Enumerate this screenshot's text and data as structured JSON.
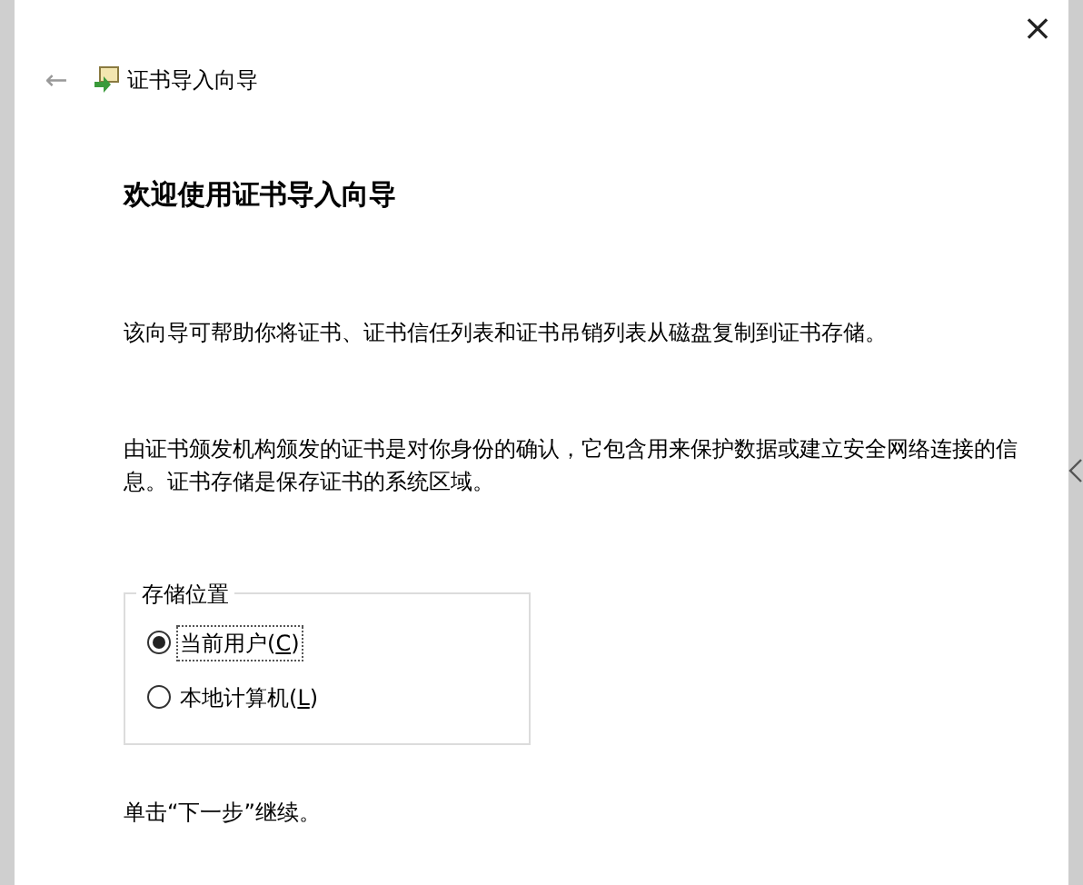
{
  "window": {
    "close_glyph": "×"
  },
  "header": {
    "back_glyph": "←",
    "title": "证书导入向导"
  },
  "heading": "欢迎使用证书导入向导",
  "paragraphs": [
    "该向导可帮助你将证书、证书信任列表和证书吊销列表从磁盘复制到证书存储。",
    "由证书颁发机构颁发的证书是对你身份的确认，它包含用来保护数据或建立安全网络连接的信息。证书存储是保存证书的系统区域。"
  ],
  "store_location": {
    "legend": "存储位置",
    "options": [
      {
        "label": "当前用户(",
        "accel": "C",
        "label_end": ")",
        "selected": true
      },
      {
        "label": "本地计算机(",
        "accel": "L",
        "label_end": ")",
        "selected": false
      }
    ]
  },
  "footer_text": "单击“下一步”继续。"
}
